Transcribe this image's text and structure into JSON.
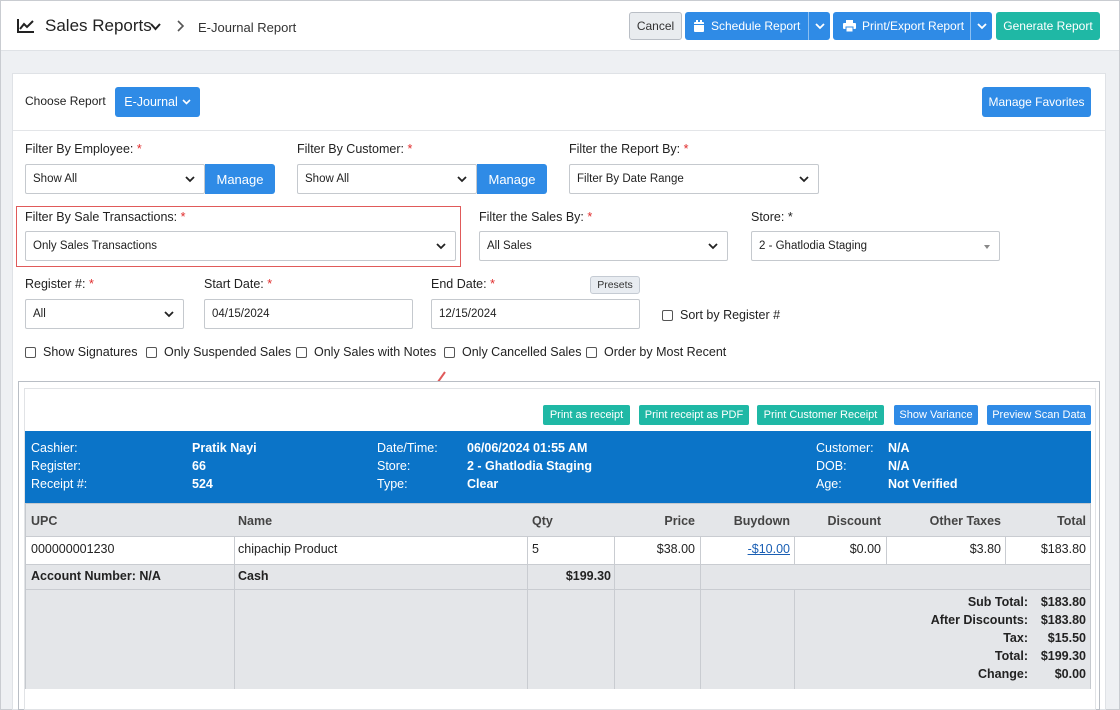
{
  "header": {
    "title": "Sales Reports",
    "breadcrumb": "E-Journal Report",
    "cancel": "Cancel",
    "schedule": "Schedule Report",
    "print_export": "Print/Export Report",
    "generate": "Generate Report"
  },
  "choose": {
    "label": "Choose Report",
    "value": "E-Journal",
    "manage_favorites": "Manage Favorites"
  },
  "filters": {
    "employee": {
      "label": "Filter By Employee:",
      "value": "Show All",
      "manage": "Manage"
    },
    "customer": {
      "label": "Filter By Customer:",
      "value": "Show All",
      "manage": "Manage"
    },
    "report_by": {
      "label": "Filter the Report By:",
      "value": "Filter By Date Range"
    },
    "sale_tx": {
      "label": "Filter By Sale Transactions:",
      "value": "Only Sales Transactions"
    },
    "sales_by": {
      "label": "Filter the Sales By:",
      "value": "All Sales"
    },
    "store": {
      "label": "Store:",
      "value": "2 - Ghatlodia Staging"
    },
    "register": {
      "label": "Register #:",
      "value": "All"
    },
    "start": {
      "label": "Start Date:",
      "value": "04/15/2024"
    },
    "end": {
      "label": "End Date:",
      "value": "12/15/2024"
    },
    "presets": "Presets",
    "sort_register": "Sort by Register #",
    "required_mark": "*"
  },
  "checkboxes": [
    "Show Signatures",
    "Only Suspended Sales",
    "Only Sales with Notes",
    "Only Cancelled Sales",
    "Order by Most Recent"
  ],
  "actions": [
    "Print as receipt",
    "Print receipt as PDF",
    "Print Customer Receipt",
    "Show Variance",
    "Preview Scan Data"
  ],
  "receipt": {
    "cashier_l": "Cashier:",
    "cashier": "Pratik Nayi",
    "register_l": "Register:",
    "register": "66",
    "receipt_l": "Receipt #:",
    "receipt": "524",
    "datetime_l": "Date/Time:",
    "datetime": "06/06/2024 01:55 AM",
    "store_l": "Store:",
    "store": "2 - Ghatlodia Staging",
    "type_l": "Type:",
    "type": "Clear",
    "customer_l": "Customer:",
    "customer": "N/A",
    "dob_l": "DOB:",
    "dob": "N/A",
    "age_l": "Age:",
    "age": "Not Verified"
  },
  "table": {
    "headers": [
      "UPC",
      "Name",
      "Qty",
      "Price",
      "Buydown",
      "Discount",
      "Other Taxes",
      "Total"
    ],
    "row": [
      "000000001230",
      "chipachip Product",
      "5",
      "$38.00",
      "-$10.00",
      "$0.00",
      "$3.80",
      "$183.80"
    ],
    "account": "Account Number: N/A",
    "payment": "Cash",
    "payment_amount": "$199.30"
  },
  "totals": [
    {
      "label": "Sub Total:",
      "value": "$183.80"
    },
    {
      "label": "After Discounts:",
      "value": "$183.80"
    },
    {
      "label": "Tax:",
      "value": "$15.50"
    },
    {
      "label": "Total:",
      "value": "$199.30"
    },
    {
      "label": "Change:",
      "value": "$0.00"
    }
  ],
  "colors": {
    "primary": "#2f8be6",
    "teal": "#1fb8a5",
    "info_bar": "#0b74c8",
    "highlight": "#e05a5a"
  }
}
